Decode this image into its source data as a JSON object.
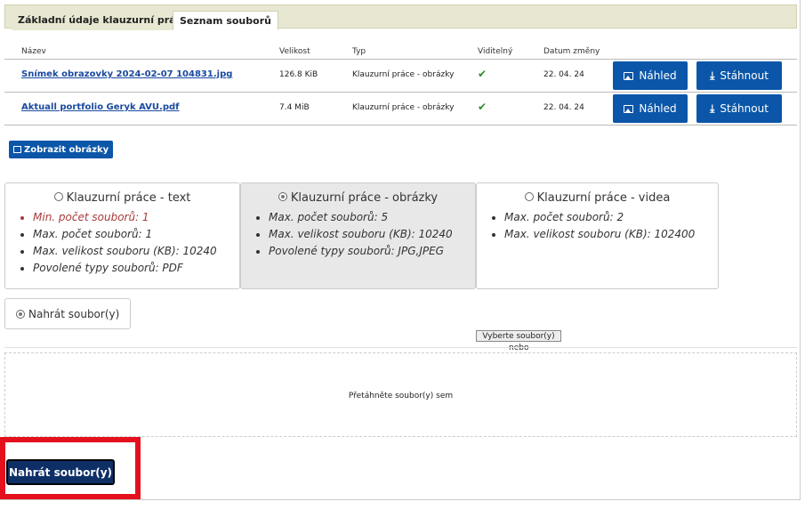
{
  "tabs": [
    "Základní údaje klauzurní práce",
    "Seznam souborů"
  ],
  "table": {
    "headers": [
      "Název",
      "Velikost",
      "Typ",
      "Viditelný",
      "Datum změny"
    ],
    "rows": [
      {
        "name": "Snímek obrazovky 2024-02-07 104831.jpg",
        "size": "126.8 KiB",
        "type": "Klauzurní práce - obrázky",
        "visible": "✔",
        "date": "22. 04. 24",
        "preview": "Náhled",
        "download": "Stáhnout"
      },
      {
        "name": "Aktuall portfolio Geryk AVU.pdf",
        "size": "7.4 MiB",
        "type": "Klauzurní práce - obrázky",
        "visible": "✔",
        "date": "22. 04. 24",
        "preview": "Náhled",
        "download": "Stáhnout"
      }
    ]
  },
  "show_images": "Zobrazit obrázky",
  "categories": [
    {
      "title": "Klauzurní práce - text",
      "selected": false,
      "items": [
        "Min. počet souborů: 1",
        "Max. počet souborů: 1",
        "Max. velikost souboru (KB): 10240",
        "Povolené typy souborů: PDF"
      ]
    },
    {
      "title": "Klauzurní práce - obrázky",
      "selected": true,
      "items": [
        "Max. počet souborů: 5",
        "Max. velikost souboru (KB): 10240",
        "Povolené typy souborů: JPG,JPEG"
      ]
    },
    {
      "title": "Klauzurní práce - videa",
      "selected": false,
      "items": [
        "Max. počet souborů: 2",
        "Max. velikost souboru (KB): 102400"
      ]
    }
  ],
  "upload_option": "Nahrát soubor(y)",
  "choose_files": "Vyberte soubor(y)",
  "or": "nebo",
  "drop_text": "Přetáhněte soubor(y) sem",
  "submit": "Nahrát soubor(y)",
  "colors": {
    "primary": "#0b56a8",
    "submit": "#0e2f66",
    "highlight": "#e4101e",
    "tabbar": "#e8e8d2"
  }
}
